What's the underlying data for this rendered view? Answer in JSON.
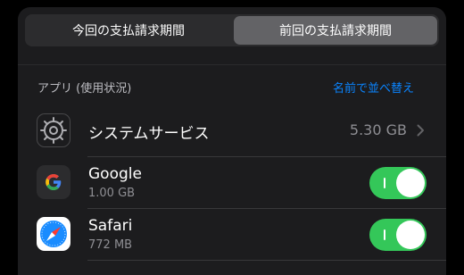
{
  "segmented": {
    "current": "今回の支払請求期間",
    "previous": "前回の支払請求期間",
    "selected": "previous"
  },
  "section": {
    "title": "アプリ (使用状況)",
    "sort_label": "名前で並べ替え"
  },
  "rows": [
    {
      "name": "システムサービス",
      "value": "5.30 GB",
      "icon": "gear-icon"
    },
    {
      "name": "Google",
      "usage": "1.00 GB",
      "icon": "google-icon",
      "enabled": true
    },
    {
      "name": "Safari",
      "usage": "772 MB",
      "icon": "safari-compass-icon",
      "enabled": true
    }
  ],
  "colors": {
    "accent": "#0a84ff",
    "toggle_on": "#34c759",
    "panel": "#1c1c1e"
  }
}
